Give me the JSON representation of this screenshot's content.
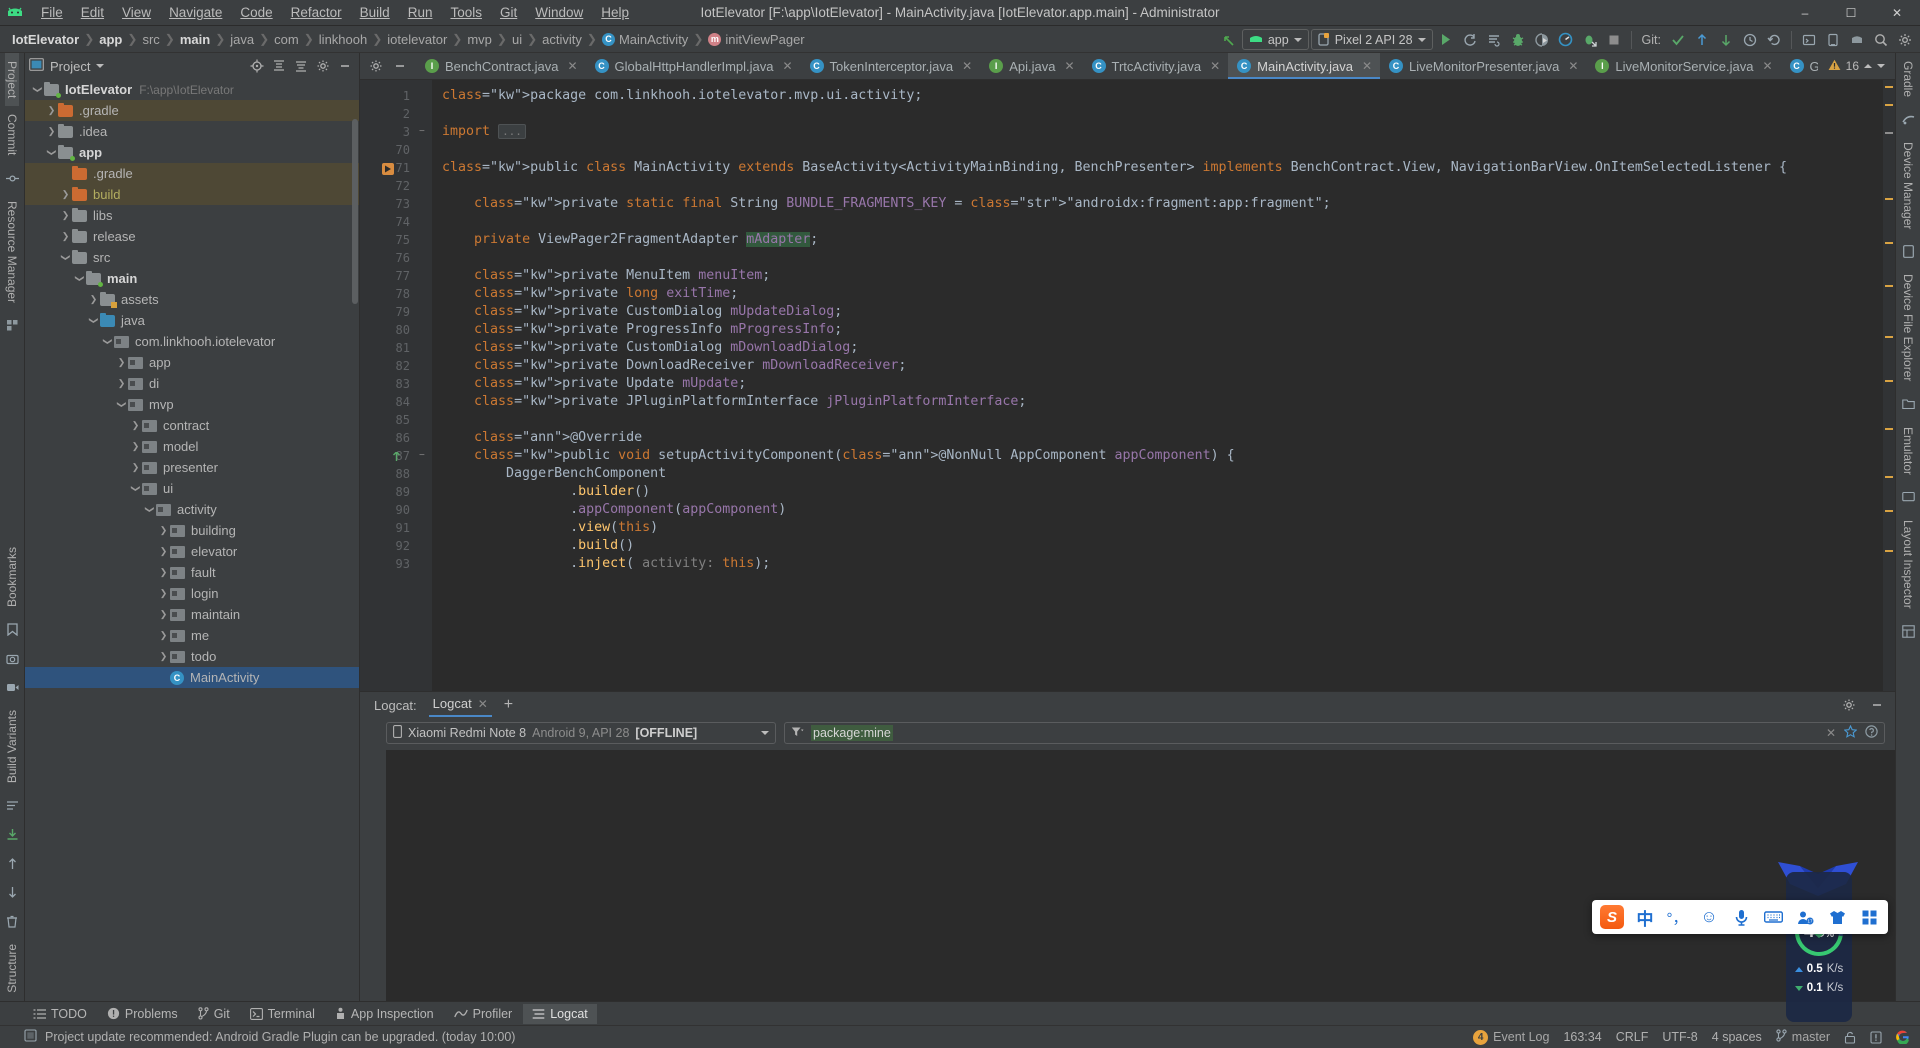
{
  "titlebar": {
    "menus": [
      "File",
      "Edit",
      "View",
      "Navigate",
      "Code",
      "Refactor",
      "Build",
      "Run",
      "Tools",
      "Git",
      "Window",
      "Help"
    ],
    "title": "IotElevator [F:\\app\\IotElevator] - MainActivity.java [IotElevator.app.main] - Administrator",
    "minimize": "–",
    "maximize": "☐",
    "close": "✕"
  },
  "navbar": {
    "crumbs": [
      {
        "label": "IotElevator",
        "bold": true,
        "icon": ""
      },
      {
        "label": "app",
        "bold": true,
        "icon": ""
      },
      {
        "label": "src",
        "bold": false,
        "icon": ""
      },
      {
        "label": "main",
        "bold": true,
        "icon": ""
      },
      {
        "label": "java",
        "bold": false,
        "icon": ""
      },
      {
        "label": "com",
        "bold": false,
        "icon": ""
      },
      {
        "label": "linkhooh",
        "bold": false,
        "icon": ""
      },
      {
        "label": "iotelevator",
        "bold": false,
        "icon": ""
      },
      {
        "label": "mvp",
        "bold": false,
        "icon": ""
      },
      {
        "label": "ui",
        "bold": false,
        "icon": ""
      },
      {
        "label": "activity",
        "bold": false,
        "icon": ""
      },
      {
        "label": "MainActivity",
        "bold": false,
        "icon": "class-icon",
        "icon_letter": "C"
      },
      {
        "label": "initViewPager",
        "bold": false,
        "icon": "method-icon",
        "icon_letter": "m"
      }
    ],
    "module_combo": "app",
    "device_combo": "Pixel 2 API 28",
    "git_label": "Git:",
    "icons": [
      "back-arrow-icon",
      "run-icon",
      "attach-debugger-icon",
      "run-with-coverage-icon",
      "debug-icon",
      "profile-icon",
      "instant-run-icon",
      "apply-changes-icon",
      "stop-icon",
      "commit-icon",
      "update-project-icon",
      "push-icon",
      "history-icon",
      "rollback-icon",
      "search-everywhere-icon",
      "settings-icon"
    ]
  },
  "project_panel": {
    "title": "Project",
    "header_icons": [
      "target-icon",
      "collapse-all-icon",
      "expand-icon",
      "settings-icon",
      "hide-icon"
    ],
    "tree": [
      {
        "indent": 0,
        "arrow": "down",
        "icon": "folder-grey-module",
        "label": "IotElevator",
        "bold": true,
        "path": "F:\\app\\IotElevator"
      },
      {
        "indent": 1,
        "arrow": "right",
        "icon": "folder-orange",
        "label": ".gradle",
        "highlight": "gradle"
      },
      {
        "indent": 1,
        "arrow": "right",
        "icon": "folder-grey",
        "label": ".idea"
      },
      {
        "indent": 1,
        "arrow": "down",
        "icon": "folder-grey-module",
        "label": "app",
        "bold": true
      },
      {
        "indent": 2,
        "arrow": "none",
        "icon": "folder-orange",
        "label": ".gradle",
        "highlight": "gradle"
      },
      {
        "indent": 2,
        "arrow": "right",
        "icon": "folder-orange",
        "label": "build",
        "yellowish": true,
        "highlight": "gradle"
      },
      {
        "indent": 2,
        "arrow": "right",
        "icon": "folder-grey",
        "label": "libs"
      },
      {
        "indent": 2,
        "arrow": "right",
        "icon": "folder-grey",
        "label": "release"
      },
      {
        "indent": 2,
        "arrow": "down",
        "icon": "folder-grey",
        "label": "src"
      },
      {
        "indent": 3,
        "arrow": "down",
        "icon": "folder-grey-module",
        "label": "main",
        "bold": true
      },
      {
        "indent": 4,
        "arrow": "right",
        "icon": "folder-assets",
        "label": "assets"
      },
      {
        "indent": 4,
        "arrow": "down",
        "icon": "folder-blue",
        "label": "java"
      },
      {
        "indent": 5,
        "arrow": "down",
        "icon": "folder-package",
        "label": "com.linkhooh.iotelevator"
      },
      {
        "indent": 6,
        "arrow": "right",
        "icon": "folder-package",
        "label": "app"
      },
      {
        "indent": 6,
        "arrow": "right",
        "icon": "folder-package",
        "label": "di"
      },
      {
        "indent": 6,
        "arrow": "down",
        "icon": "folder-package",
        "label": "mvp"
      },
      {
        "indent": 7,
        "arrow": "right",
        "icon": "folder-package",
        "label": "contract"
      },
      {
        "indent": 7,
        "arrow": "right",
        "icon": "folder-package",
        "label": "model"
      },
      {
        "indent": 7,
        "arrow": "right",
        "icon": "folder-package",
        "label": "presenter"
      },
      {
        "indent": 7,
        "arrow": "down",
        "icon": "folder-package",
        "label": "ui"
      },
      {
        "indent": 8,
        "arrow": "down",
        "icon": "folder-package",
        "label": "activity"
      },
      {
        "indent": 9,
        "arrow": "right",
        "icon": "folder-package",
        "label": "building"
      },
      {
        "indent": 9,
        "arrow": "right",
        "icon": "folder-package",
        "label": "elevator"
      },
      {
        "indent": 9,
        "arrow": "right",
        "icon": "folder-package",
        "label": "fault"
      },
      {
        "indent": 9,
        "arrow": "right",
        "icon": "folder-package",
        "label": "login"
      },
      {
        "indent": 9,
        "arrow": "right",
        "icon": "folder-package",
        "label": "maintain"
      },
      {
        "indent": 9,
        "arrow": "right",
        "icon": "folder-package",
        "label": "me"
      },
      {
        "indent": 9,
        "arrow": "right",
        "icon": "folder-package",
        "label": "todo"
      },
      {
        "indent": 9,
        "arrow": "none",
        "icon": "class-icon",
        "label": "MainActivity",
        "selected": true
      }
    ]
  },
  "editor": {
    "tabs": [
      {
        "label": "BenchContract.java",
        "icon": "interface-icon",
        "letter": "I",
        "active": false
      },
      {
        "label": "GlobalHttpHandlerImpl.java",
        "icon": "class-icon",
        "letter": "C",
        "active": false
      },
      {
        "label": "TokenInterceptor.java",
        "icon": "class-icon",
        "letter": "C",
        "active": false
      },
      {
        "label": "Api.java",
        "icon": "interface-icon",
        "letter": "I",
        "active": false
      },
      {
        "label": "TrtcActivity.java",
        "icon": "class-icon",
        "letter": "C",
        "active": false
      },
      {
        "label": "MainActivity.java",
        "icon": "class-icon",
        "letter": "C",
        "active": true
      },
      {
        "label": "LiveMonitorPresenter.java",
        "icon": "class-icon",
        "letter": "C",
        "active": false
      },
      {
        "label": "LiveMonitorService.java",
        "icon": "interface-icon",
        "letter": "I",
        "active": false
      },
      {
        "label": "GlobalConfiguration.java",
        "icon": "class-icon",
        "letter": "C",
        "active": false
      }
    ],
    "warning_count": "16",
    "lines": [
      {
        "n": "1",
        "text": "package com.linkhooh.iotelevator.mvp.ui.activity;"
      },
      {
        "n": "2",
        "text": ""
      },
      {
        "n": "3",
        "text": "import ..."
      },
      {
        "n": "70",
        "text": ""
      },
      {
        "n": "71",
        "text": "public class MainActivity extends BaseActivity<ActivityMainBinding, BenchPresenter> implements BenchContract.View, NavigationBarView.OnItemSelectedListener {"
      },
      {
        "n": "72",
        "text": ""
      },
      {
        "n": "73",
        "text": "    private static final String BUNDLE_FRAGMENTS_KEY = \"androidx:fragment:app:fragment\";"
      },
      {
        "n": "74",
        "text": ""
      },
      {
        "n": "75",
        "text": "    private ViewPager2FragmentAdapter mAdapter;"
      },
      {
        "n": "76",
        "text": ""
      },
      {
        "n": "77",
        "text": "    private MenuItem menuItem;"
      },
      {
        "n": "78",
        "text": "    private long exitTime;"
      },
      {
        "n": "79",
        "text": "    private CustomDialog mUpdateDialog;"
      },
      {
        "n": "80",
        "text": "    private ProgressInfo mProgressInfo;"
      },
      {
        "n": "81",
        "text": "    private CustomDialog mDownloadDialog;"
      },
      {
        "n": "82",
        "text": "    private DownloadReceiver mDownloadReceiver;"
      },
      {
        "n": "83",
        "text": "    private Update mUpdate;"
      },
      {
        "n": "84",
        "text": "    private JPluginPlatformInterface jPluginPlatformInterface;"
      },
      {
        "n": "85",
        "text": ""
      },
      {
        "n": "86",
        "text": "    @Override"
      },
      {
        "n": "87",
        "text": "    public void setupActivityComponent(@NonNull AppComponent appComponent) {"
      },
      {
        "n": "88",
        "text": "        DaggerBenchComponent"
      },
      {
        "n": "89",
        "text": "                .builder()"
      },
      {
        "n": "90",
        "text": "                .appComponent(appComponent)"
      },
      {
        "n": "91",
        "text": "                .view(this)"
      },
      {
        "n": "92",
        "text": "                .build()"
      },
      {
        "n": "93",
        "text": "                .inject( activity: this);"
      }
    ]
  },
  "logcat": {
    "title": "Logcat:",
    "tab_label": "Logcat",
    "add_tab": "+",
    "device": {
      "name": "Xiaomi Redmi Note 8",
      "detail": "Android 9, API 28",
      "state": "[OFFLINE]"
    },
    "filter_value": "package:mine",
    "filter_placeholder": "package:mine"
  },
  "bottom_tools": [
    {
      "label": "TODO",
      "icon": "todo-icon",
      "active": false
    },
    {
      "label": "Problems",
      "icon": "problems-icon",
      "active": false
    },
    {
      "label": "Git",
      "icon": "git-icon",
      "active": false
    },
    {
      "label": "Terminal",
      "icon": "terminal-icon",
      "active": false
    },
    {
      "label": "App Inspection",
      "icon": "inspection-icon",
      "active": false
    },
    {
      "label": "Profiler",
      "icon": "profiler-icon",
      "active": false
    },
    {
      "label": "Logcat",
      "icon": "logcat-icon",
      "active": true
    }
  ],
  "left_rail": {
    "top": [
      {
        "label": "Project",
        "selected": true
      },
      {
        "label": "Commit"
      },
      {
        "label": "Resource Manager"
      }
    ],
    "bottom": [
      {
        "label": "Structure"
      },
      {
        "label": "Build Variants"
      },
      {
        "label": "Bookmarks"
      }
    ]
  },
  "right_rail": {
    "items": [
      {
        "label": "Gradle"
      },
      {
        "label": "Device Manager"
      },
      {
        "label": "Device File Explorer"
      },
      {
        "label": "Emulator"
      },
      {
        "label": "Layout Inspector"
      }
    ]
  },
  "status_bar": {
    "message": "Project update recommended: Android Gradle Plugin can be upgraded. (today 10:00)",
    "position": "163:34",
    "line_sep": "CRLF",
    "encoding": "UTF-8",
    "indent": "4 spaces",
    "branch": "master",
    "event_log": "Event Log",
    "event_count": "4"
  },
  "float_widgets": {
    "speed": {
      "percent": "46",
      "percent_unit": "%",
      "up": "0.5",
      "up_unit": "K/s",
      "down": "0.1",
      "down_unit": "K/s"
    },
    "ime": {
      "logo": "S",
      "items": [
        "中",
        "°，",
        "☺",
        "mic-icon",
        "keyboard-icon",
        "user-icon",
        "skin-icon",
        "apps-icon"
      ]
    }
  },
  "colors": {
    "accent": "#4a88c7",
    "selection": "#2f537d",
    "editor_bg": "#2b2b2b",
    "panel_bg": "#3c3f41",
    "green": "#62b543",
    "orange": "#cc6b32"
  }
}
